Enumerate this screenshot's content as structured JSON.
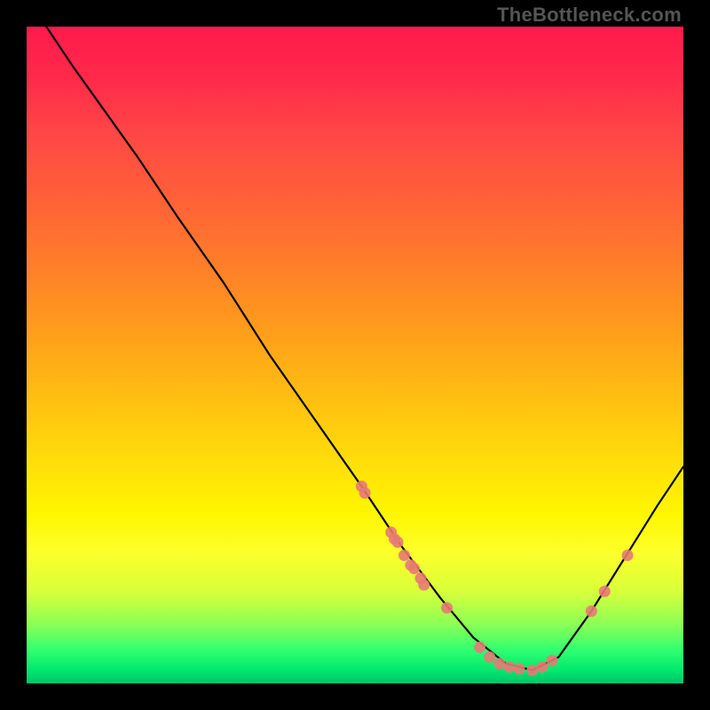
{
  "watermark": "TheBottleneck.com",
  "chart_data": {
    "type": "line",
    "title": "",
    "xlabel": "",
    "ylabel": "",
    "xlim": [
      0,
      100
    ],
    "ylim": [
      0,
      100
    ],
    "curve": {
      "name": "bottleneck-curve",
      "points": [
        {
          "x": 3,
          "y": 100
        },
        {
          "x": 7,
          "y": 94
        },
        {
          "x": 12,
          "y": 87
        },
        {
          "x": 17,
          "y": 80
        },
        {
          "x": 23,
          "y": 71
        },
        {
          "x": 30,
          "y": 61
        },
        {
          "x": 37,
          "y": 50
        },
        {
          "x": 44,
          "y": 40
        },
        {
          "x": 51,
          "y": 30
        },
        {
          "x": 57,
          "y": 21
        },
        {
          "x": 63,
          "y": 13
        },
        {
          "x": 68,
          "y": 7
        },
        {
          "x": 73,
          "y": 3
        },
        {
          "x": 77,
          "y": 2
        },
        {
          "x": 81,
          "y": 4
        },
        {
          "x": 86,
          "y": 11
        },
        {
          "x": 91,
          "y": 19
        },
        {
          "x": 96,
          "y": 27
        },
        {
          "x": 100,
          "y": 33
        }
      ]
    },
    "markers": {
      "name": "highlighted-points",
      "color": "#e77a74",
      "points": [
        {
          "x": 51.0,
          "y": 30.0
        },
        {
          "x": 51.5,
          "y": 29.0
        },
        {
          "x": 55.5,
          "y": 23.0
        },
        {
          "x": 56.0,
          "y": 22.0
        },
        {
          "x": 56.5,
          "y": 21.5
        },
        {
          "x": 57.5,
          "y": 19.5
        },
        {
          "x": 58.5,
          "y": 18.0
        },
        {
          "x": 59.0,
          "y": 17.5
        },
        {
          "x": 60.0,
          "y": 16.0
        },
        {
          "x": 60.5,
          "y": 15.0
        },
        {
          "x": 64.0,
          "y": 11.5
        },
        {
          "x": 69.0,
          "y": 5.5
        },
        {
          "x": 70.5,
          "y": 4.0
        },
        {
          "x": 72.0,
          "y": 3.0
        },
        {
          "x": 73.5,
          "y": 2.5
        },
        {
          "x": 75.0,
          "y": 2.2
        },
        {
          "x": 77.0,
          "y": 2.0
        },
        {
          "x": 78.5,
          "y": 2.5
        },
        {
          "x": 80.0,
          "y": 3.5
        },
        {
          "x": 86.0,
          "y": 11.0
        },
        {
          "x": 88.0,
          "y": 14.0
        },
        {
          "x": 91.5,
          "y": 19.5
        }
      ]
    }
  }
}
